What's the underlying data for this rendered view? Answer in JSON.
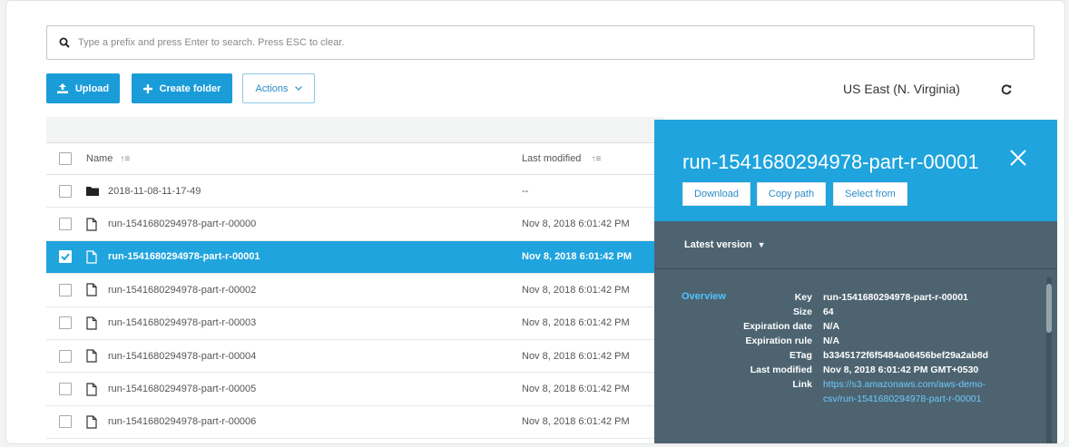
{
  "search": {
    "placeholder": "Type a prefix and press Enter to search. Press ESC to clear."
  },
  "toolbar": {
    "upload_label": "Upload",
    "create_folder_label": "Create folder",
    "actions_label": "Actions"
  },
  "region": {
    "label": "US East (N. Virginia)"
  },
  "table": {
    "columns": {
      "name": "Name",
      "last_modified": "Last modified"
    },
    "rows": [
      {
        "name": "2018-11-08-11-17-49",
        "modified": "--",
        "type": "folder",
        "selected": false
      },
      {
        "name": "run-1541680294978-part-r-00000",
        "modified": "Nov 8, 2018 6:01:42 PM",
        "type": "file",
        "selected": false
      },
      {
        "name": "run-1541680294978-part-r-00001",
        "modified": "Nov 8, 2018 6:01:42 PM",
        "type": "file",
        "selected": true
      },
      {
        "name": "run-1541680294978-part-r-00002",
        "modified": "Nov 8, 2018 6:01:42 PM",
        "type": "file",
        "selected": false
      },
      {
        "name": "run-1541680294978-part-r-00003",
        "modified": "Nov 8, 2018 6:01:42 PM",
        "type": "file",
        "selected": false
      },
      {
        "name": "run-1541680294978-part-r-00004",
        "modified": "Nov 8, 2018 6:01:42 PM",
        "type": "file",
        "selected": false
      },
      {
        "name": "run-1541680294978-part-r-00005",
        "modified": "Nov 8, 2018 6:01:42 PM",
        "type": "file",
        "selected": false
      },
      {
        "name": "run-1541680294978-part-r-00006",
        "modified": "Nov 8, 2018 6:01:42 PM",
        "type": "file",
        "selected": false
      }
    ]
  },
  "panel": {
    "title": "run-1541680294978-part-r-00001",
    "download_label": "Download",
    "copy_path_label": "Copy path",
    "select_from_label": "Select from",
    "version_label": "Latest version",
    "overview_label": "Overview",
    "details": [
      {
        "key": "Key",
        "value": "run-1541680294978-part-r-00001"
      },
      {
        "key": "Size",
        "value": "64"
      },
      {
        "key": "Expiration date",
        "value": "N/A"
      },
      {
        "key": "Expiration rule",
        "value": "N/A"
      },
      {
        "key": "ETag",
        "value": "b3345172f6f5484a06456bef29a2ab8d"
      },
      {
        "key": "Last modified",
        "value": "Nov 8, 2018 6:01:42 PM GMT+0530"
      },
      {
        "key": "Link",
        "value": "https://s3.amazonaws.com/aws-demo-csv/run-1541680294978-part-r-00001",
        "is_link": true
      }
    ]
  },
  "colors": {
    "accent": "#1fa4de",
    "panel_bg": "#4d6470",
    "link": "#6cc9ff"
  }
}
